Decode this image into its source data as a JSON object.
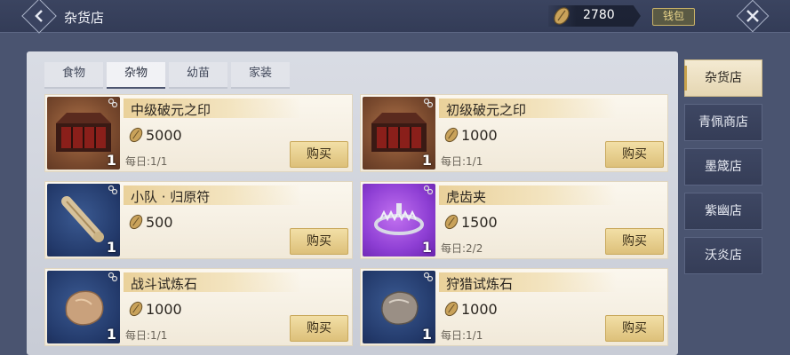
{
  "header": {
    "title": "杂货店",
    "currency_amount": "2780",
    "wallet_label": "钱包"
  },
  "tabs": [
    {
      "label": "食物",
      "active": false
    },
    {
      "label": "杂物",
      "active": true
    },
    {
      "label": "幼苗",
      "active": false
    },
    {
      "label": "家装",
      "active": false
    }
  ],
  "items": [
    {
      "name": "中级破元之印",
      "price": "5000",
      "limit": "每日:1/1",
      "qty": "1",
      "buy_label": "购买",
      "thumb_color": "orange"
    },
    {
      "name": "初级破元之印",
      "price": "1000",
      "limit": "每日:1/1",
      "qty": "1",
      "buy_label": "购买",
      "thumb_color": "orange"
    },
    {
      "name": "小队 · 归原符",
      "price": "500",
      "limit": "",
      "qty": "1",
      "buy_label": "购买",
      "thumb_color": "blue"
    },
    {
      "name": "虎齿夹",
      "price": "1500",
      "limit": "每日:2/2",
      "qty": "1",
      "buy_label": "购买",
      "thumb_color": "purple"
    },
    {
      "name": "战斗试炼石",
      "price": "1000",
      "limit": "每日:1/1",
      "qty": "1",
      "buy_label": "购买",
      "thumb_color": "blue"
    },
    {
      "name": "狩猎试炼石",
      "price": "1000",
      "limit": "每日:1/1",
      "qty": "1",
      "buy_label": "购买",
      "thumb_color": "blue"
    }
  ],
  "vendors": [
    {
      "label": "杂货店",
      "active": true
    },
    {
      "label": "青佩商店",
      "active": false
    },
    {
      "label": "墨箴店",
      "active": false
    },
    {
      "label": "紫幽店",
      "active": false
    },
    {
      "label": "沃炎店",
      "active": false
    }
  ],
  "icons": {
    "back": "back-arrow-icon",
    "close": "close-icon",
    "currency": "seed-coin-icon",
    "link": "chain-link-icon"
  },
  "colors": {
    "accent_gold": "#c8a24d",
    "card_bg": "#fbf7ee",
    "topbar_bg": "#3b4460"
  }
}
